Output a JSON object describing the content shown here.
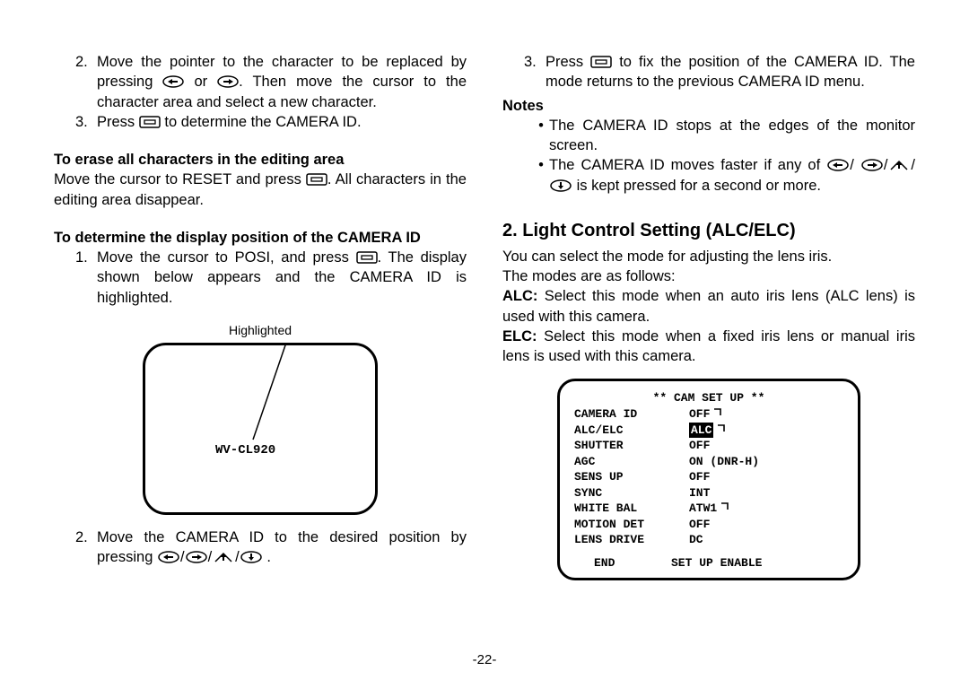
{
  "left": {
    "item2a": "Move the pointer to the character to be replaced by pressing",
    "item2b": "or",
    "item2c": ". Then move the cursor to the character area and select a new character.",
    "item3a": "Press",
    "item3b": "to determine the CAMERA ID.",
    "eraseHead": "To erase all characters in the editing area",
    "erase1": "Move the cursor to RESET and press",
    "erase2": ". All characters in the editing area disappear.",
    "posHead": "To determine the display position of the CAMERA ID",
    "pos1a": "Move the cursor to POSI, and press",
    "pos1b": ". The display shown below appears and the CAMERA ID is highlighted.",
    "highlighted": "Highlighted",
    "diagramText": "WV-CL920",
    "pos2a": "Move the CAMERA ID to the desired position by pressing",
    "pos2b": "."
  },
  "right": {
    "item3a": "Press",
    "item3b": "to fix the position of the CAMERA ID. The mode returns to the previous CAMERA ID menu.",
    "notes": "Notes",
    "note1": "The CAMERA ID stops at the edges of the monitor screen.",
    "note2a": "The CAMERA ID moves faster if any of",
    "note2b": "is kept pressed for a second or more.",
    "headline": "2. Light Control Setting (ALC/ELC)",
    "intro1": "You can select the mode for adjusting the lens iris.",
    "intro2": "The modes are as follows:",
    "alcHead": "ALC:",
    "alcBody": "Select this mode when an auto iris lens (ALC lens) is used with this camera.",
    "elcHead": "ELC:",
    "elcBody": "Select this mode when a fixed iris lens or manual iris lens is used with this camera."
  },
  "menu": {
    "title": "** CAM SET UP **",
    "rows": [
      {
        "label": "CAMERA ID",
        "val": "OFF",
        "hook": true
      },
      {
        "label": "ALC/ELC",
        "val": "ALC",
        "hl": true,
        "hook": true
      },
      {
        "label": "SHUTTER",
        "val": "OFF"
      },
      {
        "label": "AGC",
        "val": "ON (DNR-H)"
      },
      {
        "label": "SENS UP",
        "val": "OFF"
      },
      {
        "label": "SYNC",
        "val": "INT"
      },
      {
        "label": "WHITE BAL",
        "val": "ATW1",
        "hook": true
      },
      {
        "label": "MOTION DET",
        "val": "OFF"
      },
      {
        "label": "LENS DRIVE",
        "val": "DC"
      }
    ],
    "end": "END",
    "enable": "SET UP ENABLE"
  },
  "icons": {
    "btn": "nav-button-icon",
    "left": "arrow-left-icon",
    "right": "arrow-right-icon",
    "up": "arrow-up-icon",
    "down": "arrow-down-icon"
  },
  "footer": "-22-"
}
